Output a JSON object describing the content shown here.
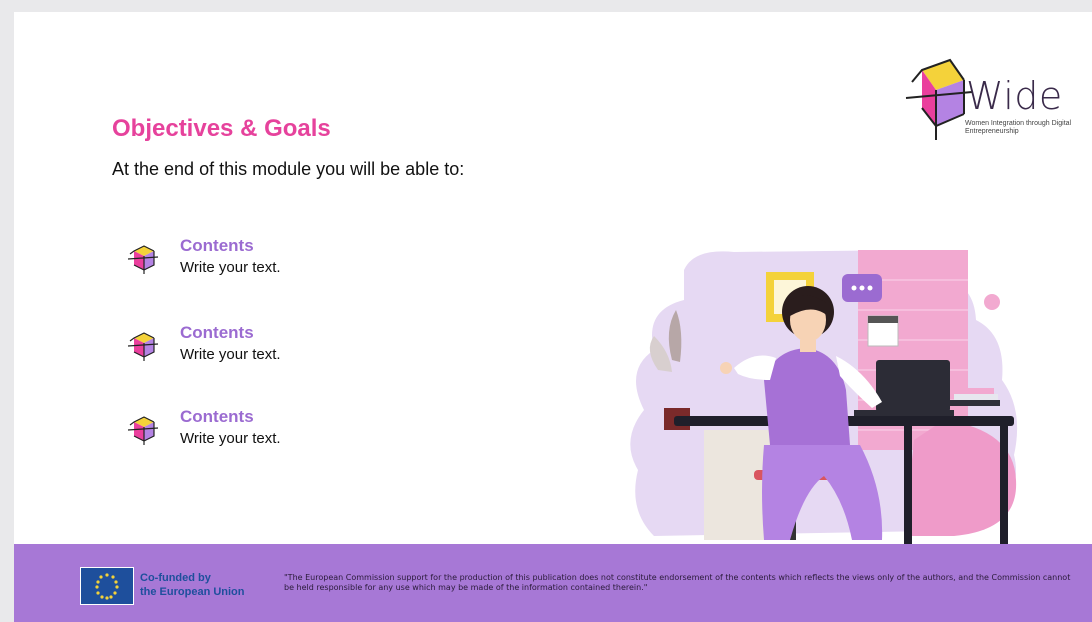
{
  "logo": {
    "word": "Wide",
    "tagline": "Women Integration through Digital Entrepreneurship"
  },
  "slide": {
    "title": "Objectives & Goals",
    "subtitle": "At the end of this module you will be able to:",
    "items": [
      {
        "heading": "Contents",
        "text": "Write your text."
      },
      {
        "heading": "Contents",
        "text": "Write your text."
      },
      {
        "heading": "Contents",
        "text": "Write your text."
      }
    ]
  },
  "footer": {
    "cofunded_line1": "Co-funded by",
    "cofunded_line2": "the European Union",
    "disclaimer": "\"The European Commission support for the production of this publication does not constitute endorsement of the contents which reflects the views only of the authors, and the Commission cannot be held responsible for any use which may be made of the information contained therein.\""
  },
  "colors": {
    "accent_pink": "#e6429c",
    "accent_purple": "#9b6bd1",
    "footer_bg": "#a778d6",
    "eu_blue": "#1e4f9c"
  }
}
